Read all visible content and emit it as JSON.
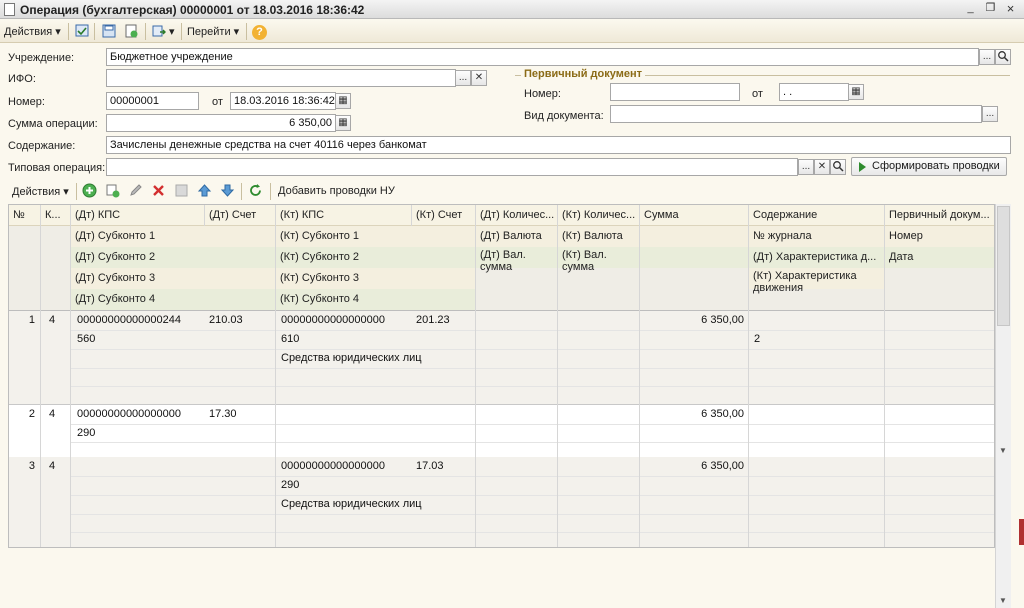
{
  "window": {
    "title": "Операция (бухгалтерская) 00000001 от 18.03.2016 18:36:42",
    "btn_minimize": "_",
    "btn_restore": "❐",
    "btn_close": "×"
  },
  "toolbar": {
    "actions_label": "Действия",
    "goto_label": "Перейти",
    "dropdown_arrow": "▾",
    "help_glyph": "?"
  },
  "form": {
    "uchrezhdenie_label": "Учреждение:",
    "uchrezhdenie_value": "Бюджетное учреждение",
    "ifo_label": "ИФО:",
    "ifo_value": "",
    "nomer_label": "Номер:",
    "nomer_value": "00000001",
    "ot_label": "от",
    "date_value": "18.03.2016 18:36:42",
    "summa_label": "Сумма операции:",
    "summa_value": "6 350,00",
    "soderzhanie_label": "Содержание:",
    "soderzhanie_value": "Зачислены денежные средства на счет 40116 через банкомат",
    "tipovaya_label": "Типовая операция:",
    "tipovaya_value": "",
    "generate_button": "Сформировать проводки",
    "ellipsis": "...",
    "clear_glyph": "✕",
    "search_glyph": "🔍",
    "calendar_glyph": "▦"
  },
  "primary_doc": {
    "title": "Первичный документ",
    "nomer_label": "Номер:",
    "nomer_value": "",
    "ot_label": "от",
    "date_value": " .  .",
    "vid_label": "Вид документа:",
    "vid_value": ""
  },
  "grid_toolbar": {
    "actions_label": "Действия",
    "add_nu_label": "Добавить проводки НУ"
  },
  "grid": {
    "header_row1": [
      "№",
      "К...",
      "(Дт) КПС",
      "(Дт) Счет",
      "(Кт) КПС",
      "(Кт) Счет",
      "(Дт) Количес...",
      "(Кт) Количес...",
      "Сумма",
      "Содержание",
      "Первичный докум..."
    ],
    "header_row2": [
      "(Дт) Субконто 1",
      "(Кт) Субконто 1",
      "(Дт) Валюта",
      "(Кт) Валюта",
      "№ журнала",
      "Номер"
    ],
    "header_row3": [
      "(Дт) Субконто 2",
      "(Кт) Субконто 2",
      "(Дт) Вал. сумма",
      "(Кт) Вал. сумма",
      "(Дт) Характеристика д...",
      "Дата"
    ],
    "header_row4": [
      "(Дт) Субконто 3",
      "(Кт) Субконто 3",
      "(Кт) Характеристика движения"
    ],
    "header_row5": [
      "(Дт) Субконто 4",
      "(Кт) Субконто 4"
    ],
    "rows": [
      {
        "num": "1",
        "k": "4",
        "dt_kps": "00000000000000244",
        "dt_schet": "210.03",
        "kt_kps": "00000000000000000",
        "kt_schet": "201.23",
        "summa": "6 350,00",
        "dt_sub1": "560",
        "kt_sub1": "610",
        "zhurnal": "2",
        "kt_sub2": "Средства юридических лиц"
      },
      {
        "num": "2",
        "k": "4",
        "dt_kps": "00000000000000000",
        "dt_schet": "17.30",
        "kt_kps": "",
        "kt_schet": "",
        "summa": "6 350,00",
        "dt_sub1": "290"
      },
      {
        "num": "3",
        "k": "4",
        "dt_kps": "",
        "dt_schet": "",
        "kt_kps": "00000000000000000",
        "kt_schet": "17.03",
        "summa": "6 350,00",
        "kt_sub1": "290",
        "kt_sub2": "Средства юридических лиц"
      }
    ]
  },
  "scroll": {
    "up": "▲",
    "down": "▼",
    "mid": "▼"
  }
}
